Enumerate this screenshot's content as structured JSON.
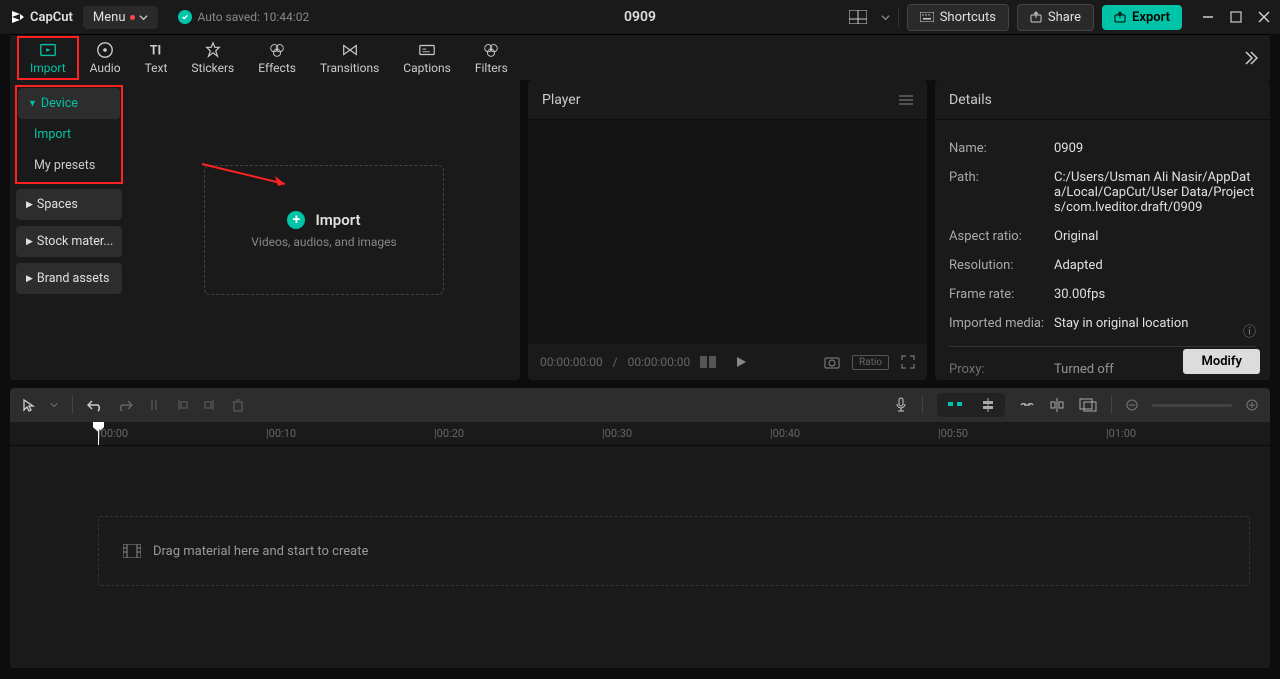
{
  "app": {
    "name": "CapCut"
  },
  "titlebar": {
    "menu_label": "Menu",
    "autosave_label": "Auto saved: 10:44:02",
    "project_title": "0909",
    "shortcuts_label": "Shortcuts",
    "share_label": "Share",
    "export_label": "Export"
  },
  "tabs": {
    "import": "Import",
    "audio": "Audio",
    "text": "Text",
    "stickers": "Stickers",
    "effects": "Effects",
    "transitions": "Transitions",
    "captions": "Captions",
    "filters": "Filters"
  },
  "sidebar": {
    "device": "Device",
    "import": "Import",
    "my_presets": "My presets",
    "spaces": "Spaces",
    "stock": "Stock mater...",
    "brand": "Brand assets"
  },
  "import_box": {
    "title": "Import",
    "subtitle": "Videos, audios, and images"
  },
  "player": {
    "title": "Player",
    "time_current": "00:00:00:00",
    "time_sep": "/",
    "time_total": "00:00:00:00",
    "ratio_label": "Ratio"
  },
  "details": {
    "title": "Details",
    "rows": {
      "name_label": "Name:",
      "name_value": "0909",
      "path_label": "Path:",
      "path_value": "C:/Users/Usman Ali Nasir/AppData/Local/CapCut/User Data/Projects/com.lveditor.draft/0909",
      "aspect_label": "Aspect ratio:",
      "aspect_value": "Original",
      "res_label": "Resolution:",
      "res_value": "Adapted",
      "fps_label": "Frame rate:",
      "fps_value": "30.00fps",
      "media_label": "Imported media:",
      "media_value": "Stay in original location",
      "proxy_label": "Proxy:",
      "proxy_value": "Turned off"
    },
    "modify_label": "Modify"
  },
  "timeline": {
    "drag_hint": "Drag material here and start to create",
    "ruler": [
      "|00:00",
      "|00:10",
      "|00:20",
      "|00:30",
      "|00:40",
      "|00:50",
      "|01:00"
    ]
  }
}
